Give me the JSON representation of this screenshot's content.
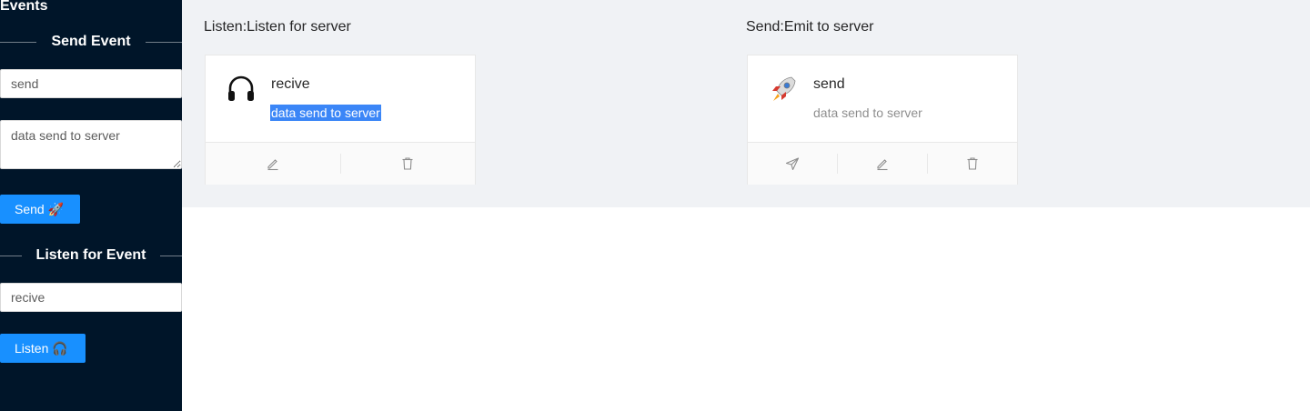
{
  "sidebar": {
    "title": "Events",
    "send_section": {
      "divider_label": "Send Event",
      "event_name_value": "send",
      "payload_value": "data send to server",
      "button_label": "Send",
      "button_emoji": "🚀"
    },
    "listen_section": {
      "divider_label": "Listen for Event",
      "event_name_value": "recive",
      "button_label": "Listen",
      "button_emoji": "🎧"
    }
  },
  "main": {
    "listen_column": {
      "title": "Listen:Listen for server",
      "card": {
        "icon": "headphones-icon",
        "avatar_glyph": "🎧",
        "title": "recive",
        "description": "data send to server",
        "actions": [
          "edit-icon",
          "delete-icon"
        ]
      }
    },
    "send_column": {
      "title": "Send:Emit to server",
      "card": {
        "icon": "rocket-icon",
        "avatar_glyph": "🚀",
        "title": "send",
        "description": "data send to server",
        "actions": [
          "send-icon",
          "edit-icon",
          "delete-icon"
        ]
      }
    }
  },
  "colors": {
    "sidebar_bg": "#001529",
    "primary": "#1890ff",
    "content_bg": "#f0f2f5",
    "selection": "#3b86f7"
  }
}
